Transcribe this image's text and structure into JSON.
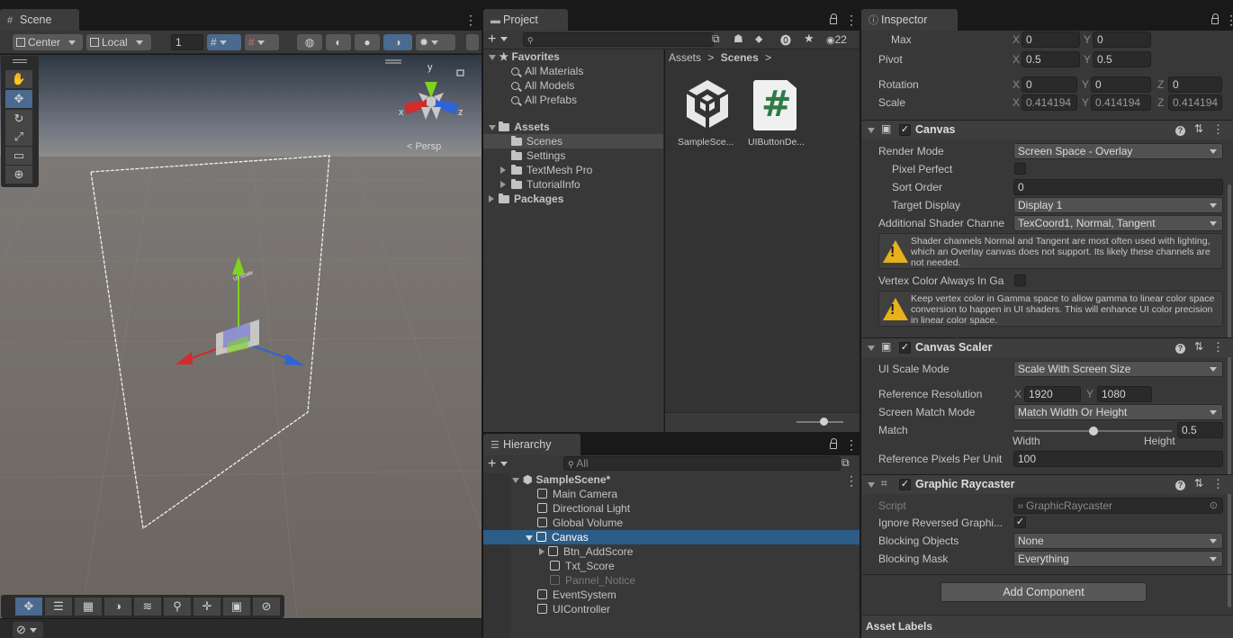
{
  "scene": {
    "tab": "Scene",
    "pivot_mode": "Center",
    "pivot_space": "Local",
    "grid_value": "1",
    "persp_label": "< Persp",
    "gizmo_axes": {
      "x": "x",
      "y": "y",
      "z": "z"
    },
    "canvas_label": "UI Scale"
  },
  "project": {
    "tab": "Project",
    "search_placeholder": "",
    "hidden_count": "22",
    "favorites_label": "Favorites",
    "favorites": [
      "All Materials",
      "All Models",
      "All Prefabs"
    ],
    "assets_label": "Assets",
    "asset_folders": [
      "Scenes",
      "Settings",
      "TextMesh Pro",
      "TutorialInfo"
    ],
    "packages_label": "Packages",
    "breadcrumb": {
      "root": "Assets",
      "sep": ">",
      "current": "Scenes",
      "tail": ">"
    },
    "files": [
      {
        "name": "SampleSce...",
        "icon": "unity-scene-icon"
      },
      {
        "name": "UIButtonDe...",
        "icon": "csharp-script-icon",
        "glyph": "#"
      }
    ]
  },
  "hierarchy": {
    "tab": "Hierarchy",
    "search_placeholder": "All",
    "scene_name": "SampleScene*",
    "items": [
      {
        "name": "Main Camera",
        "depth": 1
      },
      {
        "name": "Directional Light",
        "depth": 1
      },
      {
        "name": "Global Volume",
        "depth": 1
      },
      {
        "name": "Canvas",
        "depth": 1,
        "selected": true
      },
      {
        "name": "Btn_AddScore",
        "depth": 2
      },
      {
        "name": "Txt_Score",
        "depth": 2
      },
      {
        "name": "Pannel_Notice",
        "depth": 2,
        "inactive": true
      },
      {
        "name": "EventSystem",
        "depth": 1
      },
      {
        "name": "UIController",
        "depth": 1
      }
    ]
  },
  "inspector": {
    "tab": "Inspector",
    "rect": {
      "max_label": "Max",
      "max_x": "0",
      "max_y": "0",
      "pivot_label": "Pivot",
      "pivot_x": "0.5",
      "pivot_y": "0.5",
      "rotation_label": "Rotation",
      "rot_x": "0",
      "rot_y": "0",
      "rot_z": "0",
      "scale_label": "Scale",
      "scale_x": "0.414194",
      "scale_y": "0.414194",
      "scale_z": "0.414194"
    },
    "canvas": {
      "title": "Canvas",
      "render_mode_label": "Render Mode",
      "render_mode": "Screen Space - Overlay",
      "pixel_perfect_label": "Pixel Perfect",
      "sort_order_label": "Sort Order",
      "sort_order": "0",
      "target_display_label": "Target Display",
      "target_display": "Display 1",
      "shader_channels_label": "Additional Shader Channe",
      "shader_channels": "TexCoord1, Normal, Tangent",
      "warning1": "Shader channels Normal and Tangent are most often used with lighting, which an Overlay canvas does not support. Its likely these channels are not needed.",
      "vertex_color_label": "Vertex Color Always In Ga",
      "warning2": "Keep vertex color in Gamma space to allow gamma to linear color space conversion to happen in UI shaders. This will enhance UI color precision in linear color space."
    },
    "scaler": {
      "title": "Canvas Scaler",
      "ui_scale_mode_label": "UI Scale Mode",
      "ui_scale_mode": "Scale With Screen Size",
      "ref_res_label": "Reference Resolution",
      "ref_x": "1920",
      "ref_y": "1080",
      "match_mode_label": "Screen Match Mode",
      "match_mode": "Match Width Or Height",
      "match_label": "Match",
      "match_value": "0.5",
      "match_fraction": 0.5,
      "width_label": "Width",
      "height_label": "Height",
      "ppu_label": "Reference Pixels Per Unit",
      "ppu": "100"
    },
    "raycaster": {
      "title": "Graphic Raycaster",
      "script_label": "Script",
      "script": "GraphicRaycaster",
      "ignore_reversed_label": "Ignore Reversed Graphi...",
      "blocking_objects_label": "Blocking Objects",
      "blocking_objects": "None",
      "blocking_mask_label": "Blocking Mask",
      "blocking_mask": "Everything"
    },
    "add_component": "Add Component",
    "asset_labels": "Asset Labels"
  },
  "axis_letters": {
    "x": "X",
    "y": "Y",
    "z": "Z"
  },
  "colors": {
    "selection": "#2c5d87",
    "panel": "#383838",
    "accent_blue": "#4a6a8f",
    "warning": "#e6b11c",
    "gizmo_x": "#d22b2b",
    "gizmo_y": "#7ed321",
    "gizmo_z": "#2f64d8"
  }
}
